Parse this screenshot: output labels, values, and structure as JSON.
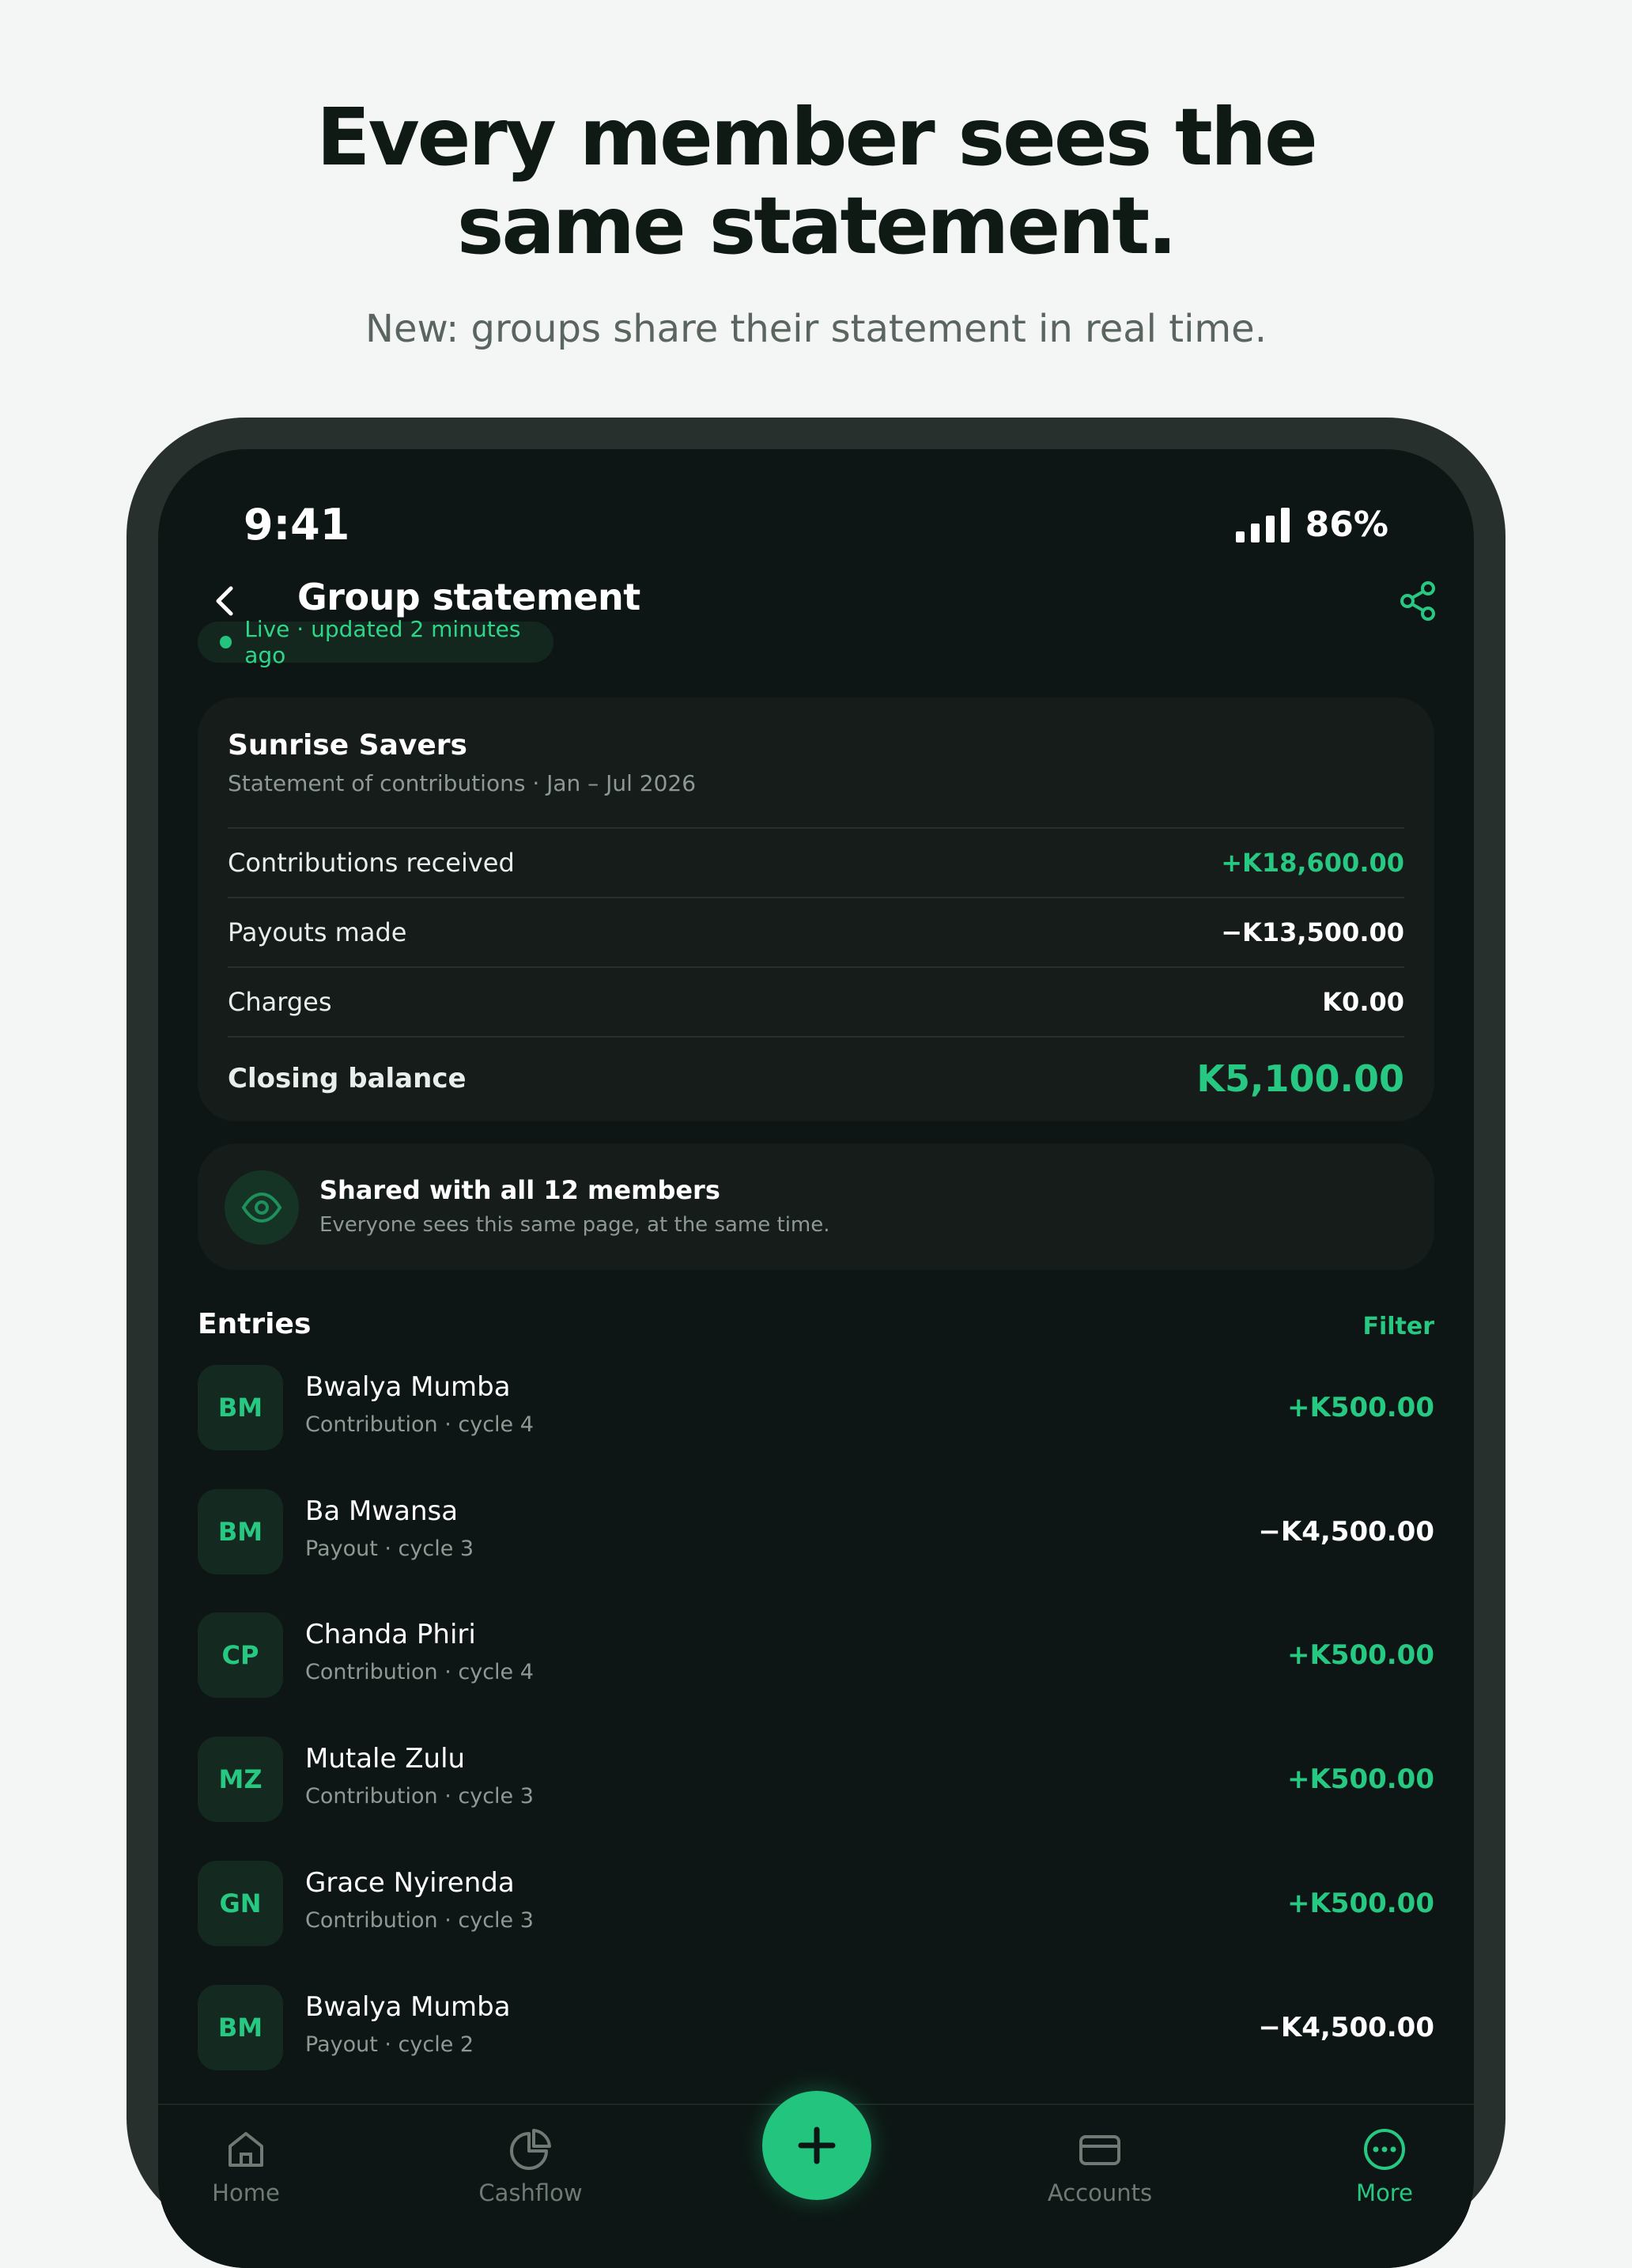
{
  "hero": {
    "title_line1": "Every member sees the",
    "title_line2": "same statement.",
    "subtitle": "New: groups share their statement in real time."
  },
  "status_bar": {
    "time": "9:41",
    "battery": "86%"
  },
  "header": {
    "title": "Group statement",
    "back_icon": "chevron-left-icon",
    "share_icon": "share-icon"
  },
  "live_badge": {
    "text": "Live · updated 2 minutes ago"
  },
  "summary": {
    "group_name": "Sunrise Savers",
    "subtitle": "Statement of contributions · Jan – Jul 2026",
    "rows": [
      {
        "label": "Contributions received",
        "value": "+K18,600.00",
        "tone": "positive"
      },
      {
        "label": "Payouts made",
        "value": "−K13,500.00",
        "tone": "neutral"
      },
      {
        "label": "Charges",
        "value": "K0.00",
        "tone": "neutral"
      }
    ],
    "closing": {
      "label": "Closing balance",
      "value": "K5,100.00"
    }
  },
  "shared": {
    "title": "Shared with all 12 members",
    "subtitle": "Everyone sees this same page, at the same time.",
    "icon": "eye-icon"
  },
  "entries": {
    "heading": "Entries",
    "filter_label": "Filter",
    "items": [
      {
        "initials": "BM",
        "name": "Bwalya Mumba",
        "detail": "Contribution · cycle 4",
        "amount": "+K500.00",
        "tone": "positive"
      },
      {
        "initials": "BM",
        "name": "Ba Mwansa",
        "detail": "Payout · cycle 3",
        "amount": "−K4,500.00",
        "tone": "neutral"
      },
      {
        "initials": "CP",
        "name": "Chanda Phiri",
        "detail": "Contribution · cycle 4",
        "amount": "+K500.00",
        "tone": "positive"
      },
      {
        "initials": "MZ",
        "name": "Mutale Zulu",
        "detail": "Contribution · cycle 3",
        "amount": "+K500.00",
        "tone": "positive"
      },
      {
        "initials": "GN",
        "name": "Grace Nyirenda",
        "detail": "Contribution · cycle 3",
        "amount": "+K500.00",
        "tone": "positive"
      },
      {
        "initials": "BM",
        "name": "Bwalya Mumba",
        "detail": "Payout · cycle 2",
        "amount": "−K4,500.00",
        "tone": "neutral"
      }
    ]
  },
  "tabbar": {
    "items": [
      {
        "label": "Home",
        "icon": "home-icon",
        "active": false
      },
      {
        "label": "Cashflow",
        "icon": "pie-chart-icon",
        "active": false
      },
      {
        "label": "Accounts",
        "icon": "card-icon",
        "active": false
      },
      {
        "label": "More",
        "icon": "more-icon",
        "active": true
      }
    ],
    "fab_icon": "plus-icon"
  },
  "colors": {
    "accent": "#27c882",
    "background": "#0d1614",
    "card": "#151c1a"
  }
}
